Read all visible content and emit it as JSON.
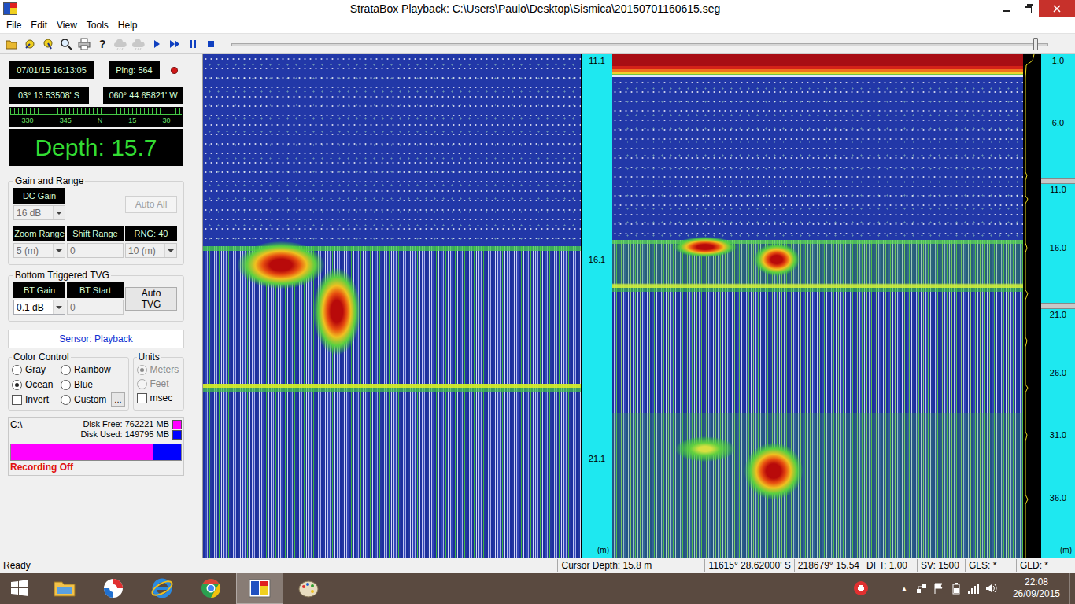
{
  "window": {
    "title": "StrataBox Playback: C:\\Users\\Paulo\\Desktop\\Sismica\\20150701160615.seg"
  },
  "menu": [
    "File",
    "Edit",
    "View",
    "Tools",
    "Help"
  ],
  "toolbar": {
    "buttons": [
      {
        "kind": "open",
        "disabled": false
      },
      {
        "kind": "mark",
        "disabled": false
      },
      {
        "kind": "mark-alt",
        "disabled": false
      },
      {
        "kind": "zoom",
        "disabled": false
      },
      {
        "kind": "print",
        "disabled": false
      },
      {
        "kind": "help",
        "glyph": "?",
        "disabled": false
      },
      {
        "kind": "cloud",
        "disabled": true
      },
      {
        "kind": "cloud",
        "disabled": true
      },
      {
        "kind": "play",
        "disabled": false
      },
      {
        "kind": "fast",
        "disabled": false
      },
      {
        "kind": "pause",
        "disabled": false
      },
      {
        "kind": "stop",
        "disabled": false
      }
    ],
    "slider": {
      "level": 0.985
    }
  },
  "readout": {
    "datetime": "07/01/15 16:13:05",
    "ping": "Ping: 564",
    "latitude": "03° 13.53508' S",
    "longitude": "060° 44.65821' W",
    "compass": [
      "330",
      "345",
      "N",
      "15",
      "30"
    ],
    "depth": "Depth: 15.7"
  },
  "gain_range": {
    "title": "Gain and Range",
    "dc_gain": {
      "label": "DC Gain",
      "value": "16 dB",
      "disabled": true
    },
    "auto_all": {
      "label": "Auto All",
      "disabled": true
    },
    "fields": [
      {
        "label": "Zoom Range",
        "value": "5 (m)",
        "kind": "dropdown",
        "disabled": true
      },
      {
        "label": "Shift Range",
        "value": "0",
        "kind": "text",
        "disabled": true
      },
      {
        "label": "RNG: 40",
        "value": "10 (m)",
        "kind": "dropdown",
        "disabled": true
      }
    ]
  },
  "tvg": {
    "title": "Bottom Triggered TVG",
    "fields": [
      {
        "label": "BT Gain",
        "value": "0.1 dB",
        "kind": "dropdown",
        "disabled": false
      },
      {
        "label": "BT Start",
        "value": "0",
        "kind": "text",
        "disabled": true
      }
    ],
    "auto_tvg": {
      "label": "Auto TVG",
      "disabled": false
    }
  },
  "sensor": "Sensor: Playback",
  "color_control": {
    "title": "Color Control",
    "options": [
      {
        "label": "Gray",
        "kind": "radio",
        "selected": false
      },
      {
        "label": "Rainbow",
        "kind": "radio",
        "selected": false
      },
      {
        "label": "Ocean",
        "kind": "radio",
        "selected": true
      },
      {
        "label": "Blue",
        "kind": "radio",
        "selected": false
      },
      {
        "label": "Invert",
        "kind": "checkbox",
        "checked": false
      },
      {
        "label": "Custom",
        "kind": "radio",
        "selected": false
      }
    ],
    "more": "..."
  },
  "units": {
    "title": "Units",
    "options": [
      {
        "label": "Meters",
        "kind": "radio",
        "selected": true,
        "disabled": true
      },
      {
        "label": "Feet",
        "kind": "radio",
        "selected": false,
        "disabled": true
      },
      {
        "label": "msec",
        "kind": "checkbox",
        "checked": false,
        "disabled": false
      }
    ]
  },
  "disk": {
    "drive": "C:\\",
    "free": {
      "label": "Disk Free: 762221 MB",
      "color": "#ff00ff"
    },
    "used": {
      "label": "Disk Used: 149795 MB",
      "color": "#0000ff"
    },
    "level": 0.836,
    "recording": "Recording Off"
  },
  "scales": {
    "left": {
      "ticks": [
        {
          "label": "11.1",
          "marked": false
        },
        {
          "label": "16.1",
          "marked": false
        },
        {
          "label": "21.1",
          "marked": false
        }
      ],
      "unit": "(m)"
    },
    "right": {
      "ticks": [
        {
          "label": "1.0",
          "marked": false
        },
        {
          "label": "6.0",
          "marked": false
        },
        {
          "label": "11.0",
          "marked": true
        },
        {
          "label": "16.0",
          "marked": false
        },
        {
          "label": "21.0",
          "marked": true
        },
        {
          "label": "26.0",
          "marked": false
        },
        {
          "label": "31.0",
          "marked": false
        },
        {
          "label": "36.0",
          "marked": false
        }
      ],
      "unit": "(m)"
    }
  },
  "status_bar": {
    "message": "Ready",
    "fields": [
      "Cursor Depth: 15.8 m",
      "11615° 28.62000' S",
      "218679° 15.54",
      "DFT: 1.00",
      "SV: 1500",
      "GLS: *",
      "GLD: *"
    ]
  },
  "taskbar": {
    "apps": [
      {
        "kind": "explorer",
        "active": false
      },
      {
        "kind": "sogou",
        "active": false
      },
      {
        "kind": "ie",
        "active": false
      },
      {
        "kind": "chrome",
        "active": false
      },
      {
        "kind": "stratabox",
        "active": true
      },
      {
        "kind": "paint",
        "active": false
      }
    ],
    "overflow": "▲",
    "tray": [
      "network",
      "flag",
      "battery",
      "signal",
      "volume"
    ],
    "time": "22:08",
    "date": "26/09/2015"
  }
}
